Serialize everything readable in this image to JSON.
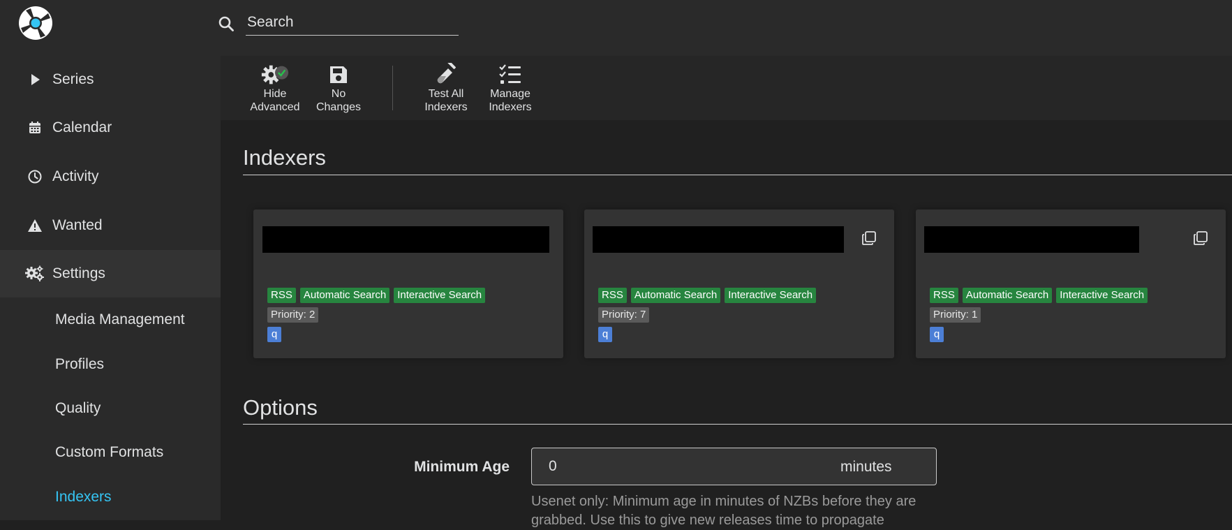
{
  "search": {
    "placeholder": "Search"
  },
  "sidebar": {
    "items": [
      {
        "label": "Series",
        "icon": "play-icon"
      },
      {
        "label": "Calendar",
        "icon": "calendar-icon"
      },
      {
        "label": "Activity",
        "icon": "clock-icon"
      },
      {
        "label": "Wanted",
        "icon": "warning-icon"
      },
      {
        "label": "Settings",
        "icon": "cogs-icon"
      }
    ],
    "settings_children": [
      {
        "label": "Media Management"
      },
      {
        "label": "Profiles"
      },
      {
        "label": "Quality"
      },
      {
        "label": "Custom Formats"
      },
      {
        "label": "Indexers"
      }
    ],
    "selected_child": "Indexers"
  },
  "toolbar": {
    "buttons": [
      {
        "label": "Hide\nAdvanced",
        "icon": "advanced-settings-icon"
      },
      {
        "label": "No\nChanges",
        "icon": "save-icon"
      },
      {
        "label": "Test All\nIndexers",
        "icon": "test-tube-icon"
      },
      {
        "label": "Manage\nIndexers",
        "icon": "checklist-icon"
      }
    ]
  },
  "indexers_section": {
    "title": "Indexers"
  },
  "indexer_cards": [
    {
      "tags": [
        "RSS",
        "Automatic Search",
        "Interactive Search"
      ],
      "priority": "Priority: 2",
      "protocol": "q"
    },
    {
      "tags": [
        "RSS",
        "Automatic Search",
        "Interactive Search"
      ],
      "priority": "Priority: 7",
      "protocol": "q"
    },
    {
      "tags": [
        "RSS",
        "Automatic Search",
        "Interactive Search"
      ],
      "priority": "Priority: 1",
      "protocol": "q"
    }
  ],
  "options_section": {
    "title": "Options"
  },
  "minimum_age": {
    "label": "Minimum Age",
    "value": "0",
    "unit": "minutes",
    "help": "Usenet only: Minimum age in minutes of NZBs before they are grabbed. Use this to give new releases time to propagate"
  },
  "colors": {
    "accent": "#35c5f4",
    "tag_green": "#27853f",
    "tag_gray": "#5a5a5a",
    "tag_blue": "#4c7fd6",
    "sidebar_bg": "#2a2a2a",
    "page_bg": "#202020"
  }
}
